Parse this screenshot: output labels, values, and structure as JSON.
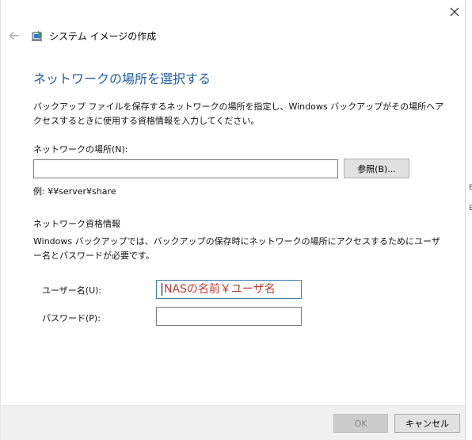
{
  "window": {
    "title": "システム イメージの作成"
  },
  "page": {
    "heading": "ネットワークの場所を選択する",
    "description": "バックアップ ファイルを保存するネットワークの場所を指定し、Windows バックアップがその場所へアクセスするときに使用する資格情報を入力してください。"
  },
  "network_location": {
    "label": "ネットワークの場所(N):",
    "value": "",
    "browse_label": "参照(B)...",
    "example": "例: ¥¥server¥share"
  },
  "credentials": {
    "section_title": "ネットワーク資格情報",
    "description": "Windows バックアップでは、バックアップの保存時にネットワークの場所にアクセスするためにユーザー名とパスワードが必要です。",
    "username_label": "ユーザー名(U):",
    "username_value": "NASの名前￥ユーザ名",
    "password_label": "パスワード(P):",
    "password_value": ""
  },
  "footer": {
    "ok_label": "OK",
    "cancel_label": "キャンセル"
  },
  "icons": {
    "close": "close-icon",
    "back": "back-arrow-icon",
    "app": "system-image-backup-icon"
  },
  "colors": {
    "heading": "#1f5fa6",
    "username_text": "#c0392b"
  }
}
